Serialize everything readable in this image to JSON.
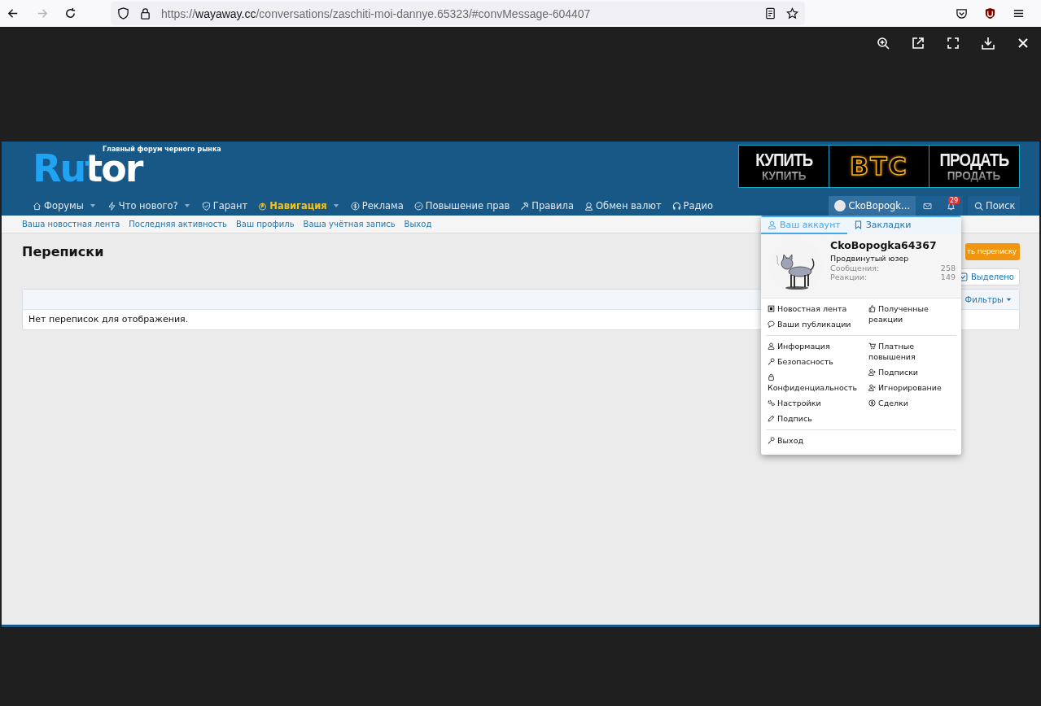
{
  "browser": {
    "back": {
      "disabled": false
    },
    "forward": {
      "disabled": true
    },
    "url_parts": [
      "https://",
      "wayaway.cc",
      "/conversations/zaschiti-moi-dannye.65323/#convMessage-604407"
    ]
  },
  "site": {
    "logo": "Rutor",
    "tagline": "Главный форум черного рынка",
    "banner": [
      {
        "text": "КУПИТЬ",
        "reflection": "КУПИТЬ",
        "kind": "word"
      },
      {
        "text": "BTC",
        "kind": "neon"
      },
      {
        "text": "ПРОДАТЬ",
        "reflection": "ПРОДАТЬ",
        "kind": "word"
      }
    ],
    "nav": [
      {
        "label": "Форумы",
        "dropdown": true,
        "highlighted": false
      },
      {
        "label": "Что нового?",
        "dropdown": true,
        "highlighted": false
      },
      {
        "label": "Гарант",
        "dropdown": false,
        "highlighted": false
      },
      {
        "label": "Навигация",
        "dropdown": true,
        "highlighted": true
      },
      {
        "label": "Реклама",
        "dropdown": false,
        "highlighted": false
      },
      {
        "label": "Повышение прав",
        "dropdown": false,
        "highlighted": false
      },
      {
        "label": "Правила",
        "dropdown": false,
        "highlighted": false
      },
      {
        "label": "Обмен валют",
        "dropdown": false,
        "highlighted": false
      },
      {
        "label": "Радио",
        "dropdown": false,
        "highlighted": false
      }
    ],
    "user_tab": {
      "label": "CkoBopogk...",
      "selected": true
    },
    "alerts_badge": "29",
    "search": "Поиск",
    "subnav": [
      "Ваша новостная лента",
      "Последняя активность",
      "Ваш профиль",
      "Ваша учётная запись",
      "Выход"
    ],
    "page_title": "Переписки",
    "start_button": "ть переписку",
    "selected_button": {
      "label": "Выделено",
      "checked": true
    },
    "filters": "Фильтры",
    "empty_message": "Нет переписок для отображения.",
    "account_menu": {
      "tabs": [
        {
          "label": "Ваш аккаунт",
          "selected": true
        },
        {
          "label": "Закладки",
          "selected": false
        }
      ],
      "username": "CkoBopogka64367",
      "user_title": "Продвинутый юзер",
      "stats": [
        {
          "label": "Сообщения:",
          "value": "258"
        },
        {
          "label": "Реакции:",
          "value": "149"
        }
      ],
      "sections": [
        {
          "left": [
            "Новостная лента",
            "Ваши публикации"
          ],
          "right": [
            "Полученные реакции"
          ]
        },
        {
          "left": [
            "Информация",
            "Безопасность",
            "Конфиденциальность",
            "Настройки",
            "Подпись"
          ],
          "right": [
            "Платные повышения",
            "Подписки",
            "Игнорирование",
            "Сделки"
          ]
        },
        {
          "left": [
            "Выход"
          ]
        }
      ]
    }
  }
}
